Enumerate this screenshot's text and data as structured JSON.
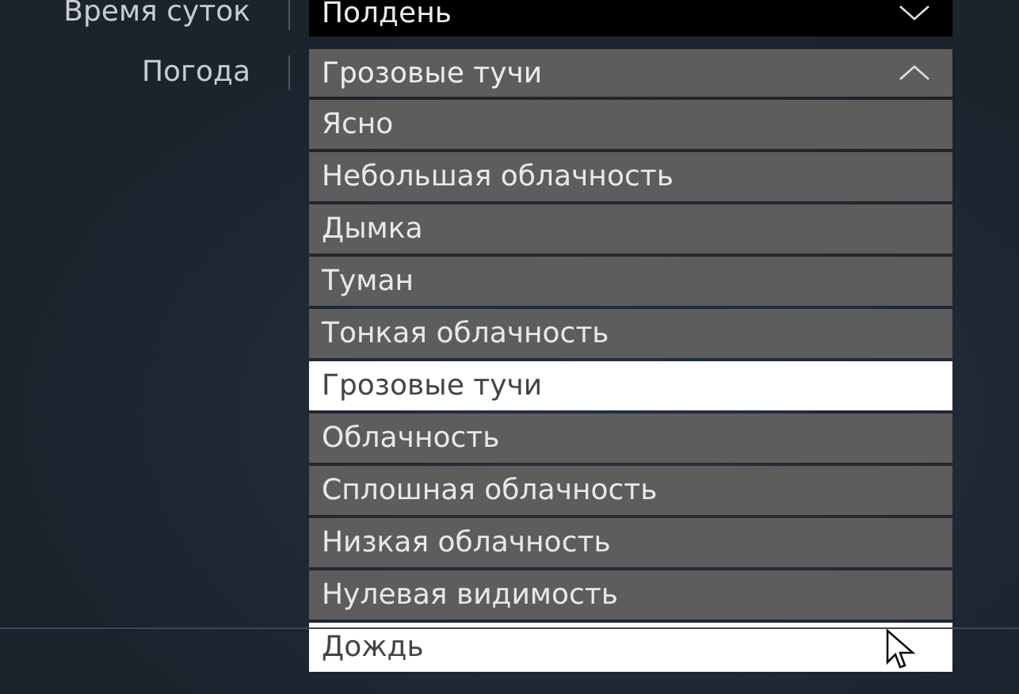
{
  "rows": [
    {
      "label": "Время суток",
      "value": "Полдень",
      "expanded": false
    },
    {
      "label": "Погода",
      "value": "Грозовые тучи",
      "expanded": true,
      "options": [
        {
          "label": "Ясно",
          "selected": false,
          "hovered": false
        },
        {
          "label": "Небольшая облачность",
          "selected": false,
          "hovered": false
        },
        {
          "label": "Дымка",
          "selected": false,
          "hovered": false
        },
        {
          "label": "Туман",
          "selected": false,
          "hovered": false
        },
        {
          "label": "Тонкая облачность",
          "selected": false,
          "hovered": false
        },
        {
          "label": "Грозовые тучи",
          "selected": true,
          "hovered": false
        },
        {
          "label": "Облачность",
          "selected": false,
          "hovered": false
        },
        {
          "label": "Сплошная облачность",
          "selected": false,
          "hovered": false
        },
        {
          "label": "Низкая облачность",
          "selected": false,
          "hovered": false
        },
        {
          "label": "Нулевая видимость",
          "selected": false,
          "hovered": false
        },
        {
          "label": "Дождь",
          "selected": false,
          "hovered": true
        }
      ]
    }
  ]
}
